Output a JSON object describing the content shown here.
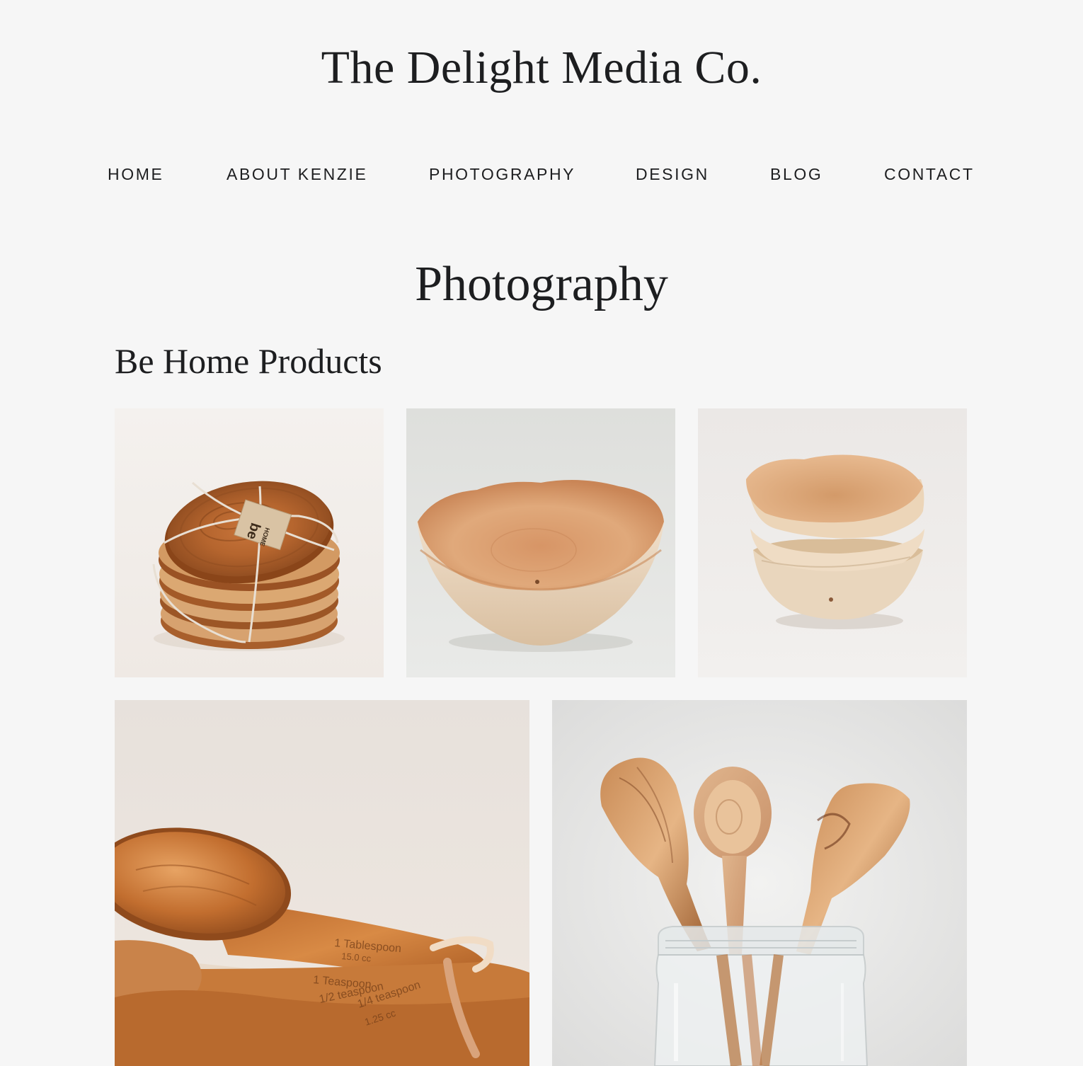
{
  "site": {
    "title": "The Delight Media Co."
  },
  "nav": {
    "items": [
      {
        "label": "HOME"
      },
      {
        "label": "ABOUT KENZIE"
      },
      {
        "label": "PHOTOGRAPHY"
      },
      {
        "label": "DESIGN"
      },
      {
        "label": "BLOG"
      },
      {
        "label": "CONTACT"
      }
    ]
  },
  "page": {
    "title": "Photography"
  },
  "section": {
    "title": "Be Home Products",
    "photos": [
      {
        "subject": "stacked-wooden-plates"
      },
      {
        "subject": "wooden-bowl"
      },
      {
        "subject": "stacked-wooden-bowls"
      },
      {
        "subject": "wooden-measuring-spoons",
        "engraved_text": [
          "1 Tablespoon",
          "15.0 cc",
          "1 Teaspoon",
          "1/2 teaspoon",
          "1/4 teaspoon",
          "1.25 cc"
        ]
      },
      {
        "subject": "wooden-spoons-in-jar"
      }
    ]
  },
  "colors": {
    "background": "#f6f6f6",
    "text": "#1d1e20"
  }
}
